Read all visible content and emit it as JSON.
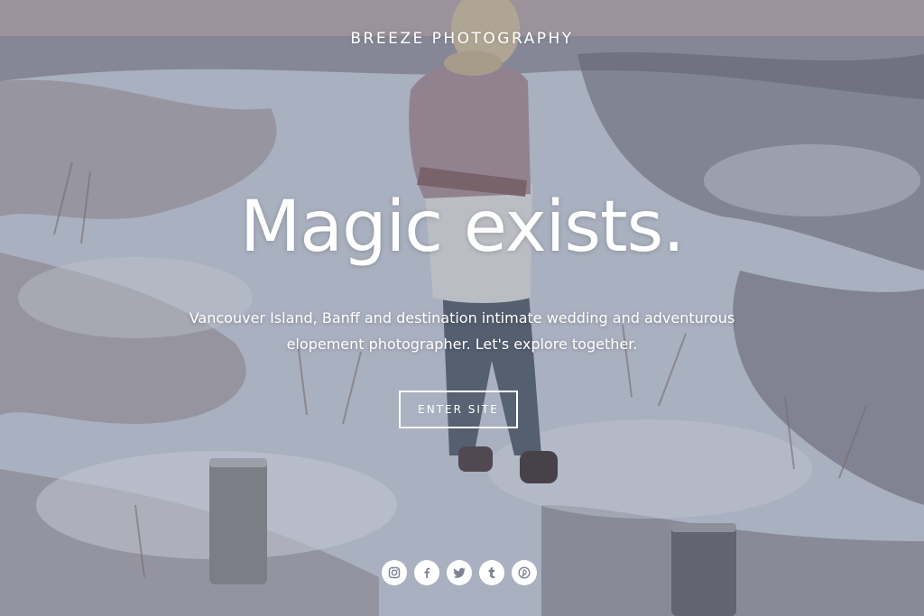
{
  "hero": {
    "brand": "BREEZE PHOTOGRAPHY",
    "headline": "Magic exists.",
    "tagline": "Vancouver Island, Banff and destination intimate wedding and adventurous elopement photographer. Let's explore together.",
    "cta_label": "ENTER SITE",
    "text_color": "#ffffff"
  },
  "social": {
    "icons": [
      "instagram-icon",
      "facebook-icon",
      "twitter-icon",
      "tumblr-icon",
      "pinterest-icon"
    ],
    "icon_color": "#7d8296"
  }
}
